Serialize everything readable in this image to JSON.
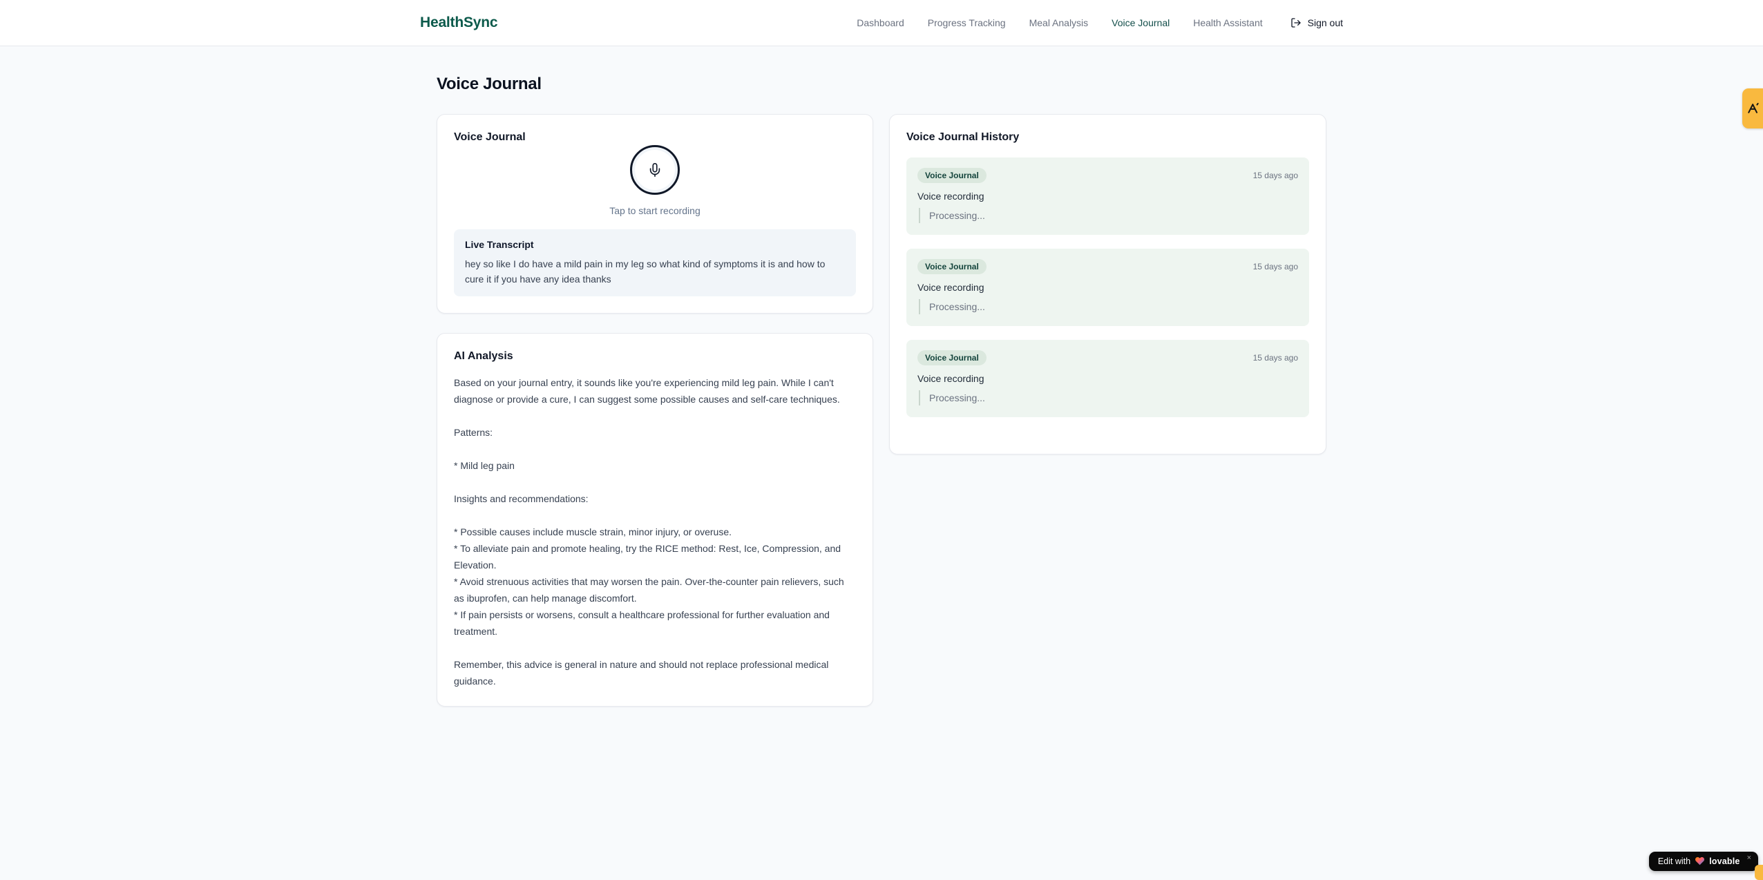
{
  "brand": {
    "name": "HealthSync"
  },
  "nav": {
    "items": [
      {
        "label": "Dashboard",
        "active": false
      },
      {
        "label": "Progress Tracking",
        "active": false
      },
      {
        "label": "Meal Analysis",
        "active": false
      },
      {
        "label": "Voice Journal",
        "active": true
      },
      {
        "label": "Health Assistant",
        "active": false
      }
    ],
    "sign_out_label": "Sign out"
  },
  "page": {
    "title": "Voice Journal"
  },
  "recorder_card": {
    "title": "Voice Journal",
    "tap_hint": "Tap to start recording",
    "transcript_title": "Live Transcript",
    "transcript_text": "hey so like I do have a mild pain in my leg so what kind of symptoms it is and how to cure it if you have any idea thanks"
  },
  "analysis_card": {
    "title": "AI Analysis",
    "body": "Based on your journal entry, it sounds like you're experiencing mild leg pain. While I can't diagnose or provide a cure, I can suggest some possible causes and self-care techniques.\n\nPatterns:\n\n* Mild leg pain\n\nInsights and recommendations:\n\n* Possible causes include muscle strain, minor injury, or overuse.\n* To alleviate pain and promote healing, try the RICE method: Rest, Ice, Compression, and Elevation.\n* Avoid strenuous activities that may worsen the pain. Over-the-counter pain relievers, such as ibuprofen, can help manage discomfort.\n* If pain persists or worsens, consult a healthcare professional for further evaluation and treatment.\n\nRemember, this advice is general in nature and should not replace professional medical guidance."
  },
  "history": {
    "title": "Voice Journal History",
    "entries": [
      {
        "badge": "Voice Journal",
        "time": "15 days ago",
        "label": "Voice recording",
        "status": "Processing..."
      },
      {
        "badge": "Voice Journal",
        "time": "15 days ago",
        "label": "Voice recording",
        "status": "Processing..."
      },
      {
        "badge": "Voice Journal",
        "time": "15 days ago",
        "label": "Voice recording",
        "status": "Processing..."
      }
    ]
  },
  "widgets": {
    "lovable_prefix": "Edit with",
    "lovable_brand": "lovable",
    "lovable_close": "×"
  },
  "colors": {
    "brand_green": "#0c5a4b",
    "nav_active": "#134e4a",
    "page_bg": "#f8fafc",
    "history_bg": "#eef5f0",
    "badge_bg": "#dbe8de",
    "tab_orange": "#f9b93f",
    "lovable_bg": "#0a0a0a"
  }
}
